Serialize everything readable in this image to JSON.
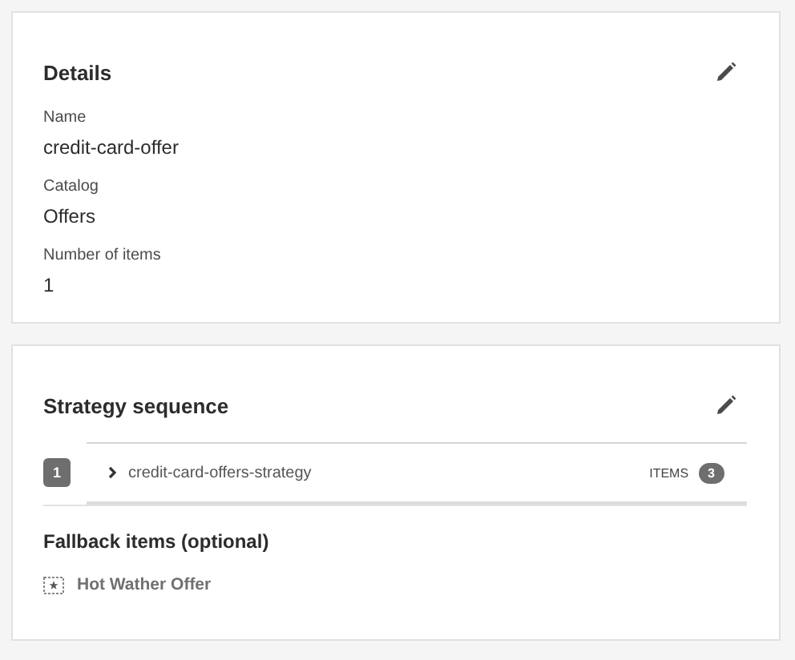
{
  "details": {
    "title": "Details",
    "fields": [
      {
        "label": "Name",
        "value": "credit-card-offer"
      },
      {
        "label": "Catalog",
        "value": "Offers"
      },
      {
        "label": "Number of items",
        "value": "1"
      }
    ]
  },
  "strategy": {
    "title": "Strategy sequence",
    "rows": [
      {
        "index": "1",
        "name": "credit-card-offers-strategy",
        "items_label": "ITEMS",
        "count": "3",
        "expanded": false
      }
    ],
    "fallback_title": "Fallback items (optional)",
    "fallback_items": [
      "Hot Wather Offer"
    ]
  }
}
